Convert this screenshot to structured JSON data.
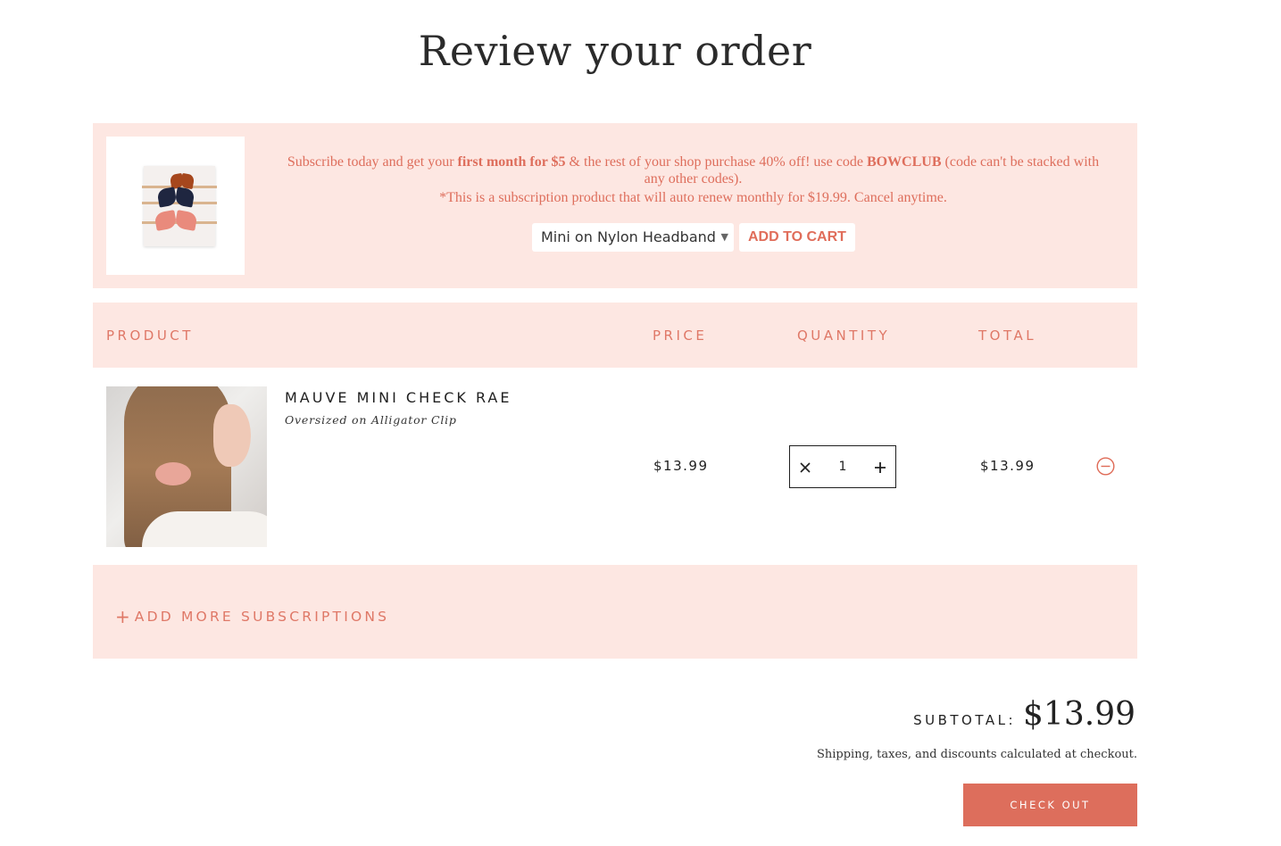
{
  "page": {
    "title": "Review your order"
  },
  "promo": {
    "text_pre": "Subscribe today and get your ",
    "text_bold1": "first month for $5",
    "text_mid": " & the rest of your shop purchase 40% off! use code ",
    "text_bold2": "BOWCLUB",
    "text_post": " (code can't be stacked with any other codes).",
    "note": "*This is a subscription product that will auto renew monthly for $19.99. Cancel anytime.",
    "select_value": "Mini on Nylon Headband",
    "add_to_cart_label": "ADD TO CART"
  },
  "table": {
    "headers": {
      "product": "PRODUCT",
      "price": "PRICE",
      "quantity": "QUANTITY",
      "total": "TOTAL"
    },
    "rows": [
      {
        "name": "MAUVE MINI CHECK RAE",
        "variant": "Oversized on Alligator Clip",
        "price": "$13.99",
        "quantity": "1",
        "total": "$13.99"
      }
    ]
  },
  "add_more": {
    "label": "ADD MORE SUBSCRIPTIONS"
  },
  "summary": {
    "subtotal_label": "SUBTOTAL:",
    "subtotal_value": "$13.99",
    "shipping_note": "Shipping, taxes, and discounts calculated at checkout.",
    "checkout_label": "CHECK OUT"
  },
  "icons": {
    "qty_minus": "close-x-icon",
    "qty_plus": "plus-icon",
    "remove": "minus-circle-icon",
    "select_arrow": "caret-down-icon"
  },
  "colors": {
    "accent": "#dd6e5c",
    "panel": "#fde7e2"
  }
}
